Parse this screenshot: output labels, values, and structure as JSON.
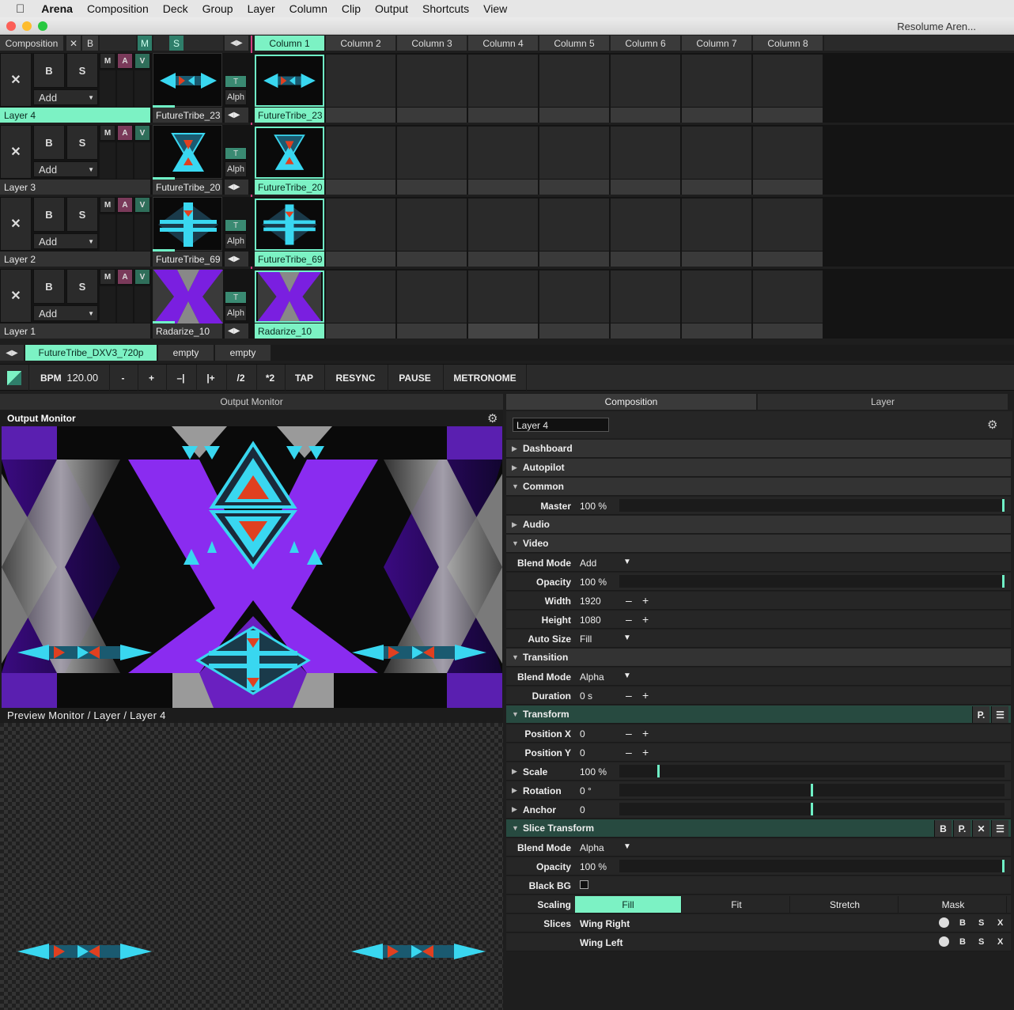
{
  "menubar": {
    "app": "Arena",
    "items": [
      "Composition",
      "Deck",
      "Group",
      "Layer",
      "Column",
      "Clip",
      "Output",
      "Shortcuts",
      "View"
    ]
  },
  "window": {
    "title": "Resolume Aren..."
  },
  "header": {
    "composition": "Composition",
    "x": "✕",
    "b": "B",
    "m": "M",
    "s": "S",
    "columns": [
      "Column 1",
      "Column 2",
      "Column 3",
      "Column 4",
      "Column 5",
      "Column 6",
      "Column 7",
      "Column 8"
    ]
  },
  "layer_controls": {
    "b": "B",
    "s": "S",
    "add": "Add",
    "m": "M",
    "a": "A",
    "v": "V",
    "t": "T",
    "alph": "Alph",
    "x": "✕"
  },
  "layers": [
    {
      "name": "Layer 4",
      "clip": "FutureTribe_23",
      "col1": "FutureTribe_23"
    },
    {
      "name": "Layer 3",
      "clip": "FutureTribe_20",
      "col1": "FutureTribe_20"
    },
    {
      "name": "Layer 2",
      "clip": "FutureTribe_69",
      "col1": "FutureTribe_69"
    },
    {
      "name": "Layer 1",
      "clip": "Radarize_10",
      "col1": "Radarize_10"
    }
  ],
  "decks": [
    "FutureTribe_DXV3_720p",
    "empty",
    "empty"
  ],
  "transport": {
    "bpm_label": "BPM",
    "bpm": "120.00",
    "buttons": [
      "-",
      "+",
      "–|",
      "|+",
      "/2",
      "*2",
      "TAP",
      "RESYNC",
      "PAUSE",
      "METRONOME"
    ]
  },
  "monitors": {
    "output_header": "Output Monitor",
    "output_title": "Output Monitor",
    "preview_title": "Preview Monitor / Layer / Layer 4"
  },
  "props": {
    "tabs": [
      "Composition",
      "Layer"
    ],
    "layer_name": "Layer 4",
    "sections": {
      "dashboard": "Dashboard",
      "autopilot": "Autopilot",
      "common": "Common",
      "audio": "Audio",
      "video": "Video",
      "transition": "Transition",
      "transform": "Transform",
      "slice": "Slice Transform"
    },
    "master": {
      "label": "Master",
      "value": "100 %",
      "level": 1.0
    },
    "video": {
      "blend_label": "Blend Mode",
      "blend": "Add",
      "opacity_label": "Opacity",
      "opacity": "100 %",
      "opacity_level": 1.0,
      "width_label": "Width",
      "width": "1920",
      "height_label": "Height",
      "height": "1080",
      "autosize_label": "Auto Size",
      "autosize": "Fill"
    },
    "transition": {
      "blend_label": "Blend Mode",
      "blend": "Alpha",
      "duration_label": "Duration",
      "duration": "0 s"
    },
    "transform": {
      "p_btn": "P.",
      "posx_label": "Position X",
      "posx": "0",
      "posy_label": "Position Y",
      "posy": "0",
      "scale_label": "Scale",
      "scale": "100 %",
      "rotation_label": "Rotation",
      "rotation": "0 °",
      "anchor_label": "Anchor",
      "anchor": "0"
    },
    "slice": {
      "b_btn": "B",
      "p_btn": "P.",
      "x_btn": "✕",
      "blend_label": "Blend Mode",
      "blend": "Alpha",
      "opacity_label": "Opacity",
      "opacity": "100 %",
      "opacity_level": 1.0,
      "blackbg_label": "Black BG",
      "scaling_label": "Scaling",
      "scaling": [
        "Fill",
        "Fit",
        "Stretch",
        "Mask"
      ],
      "slices_label": "Slices",
      "slices": [
        "Wing Right",
        "Wing Left"
      ],
      "slice_btns": [
        "B",
        "S",
        "X"
      ]
    },
    "pm": {
      "minus": "–",
      "plus": "+"
    }
  },
  "colors": {
    "accent": "#7cf2c4",
    "cyan": "#39d7f0",
    "purple": "#7a1fe0"
  }
}
